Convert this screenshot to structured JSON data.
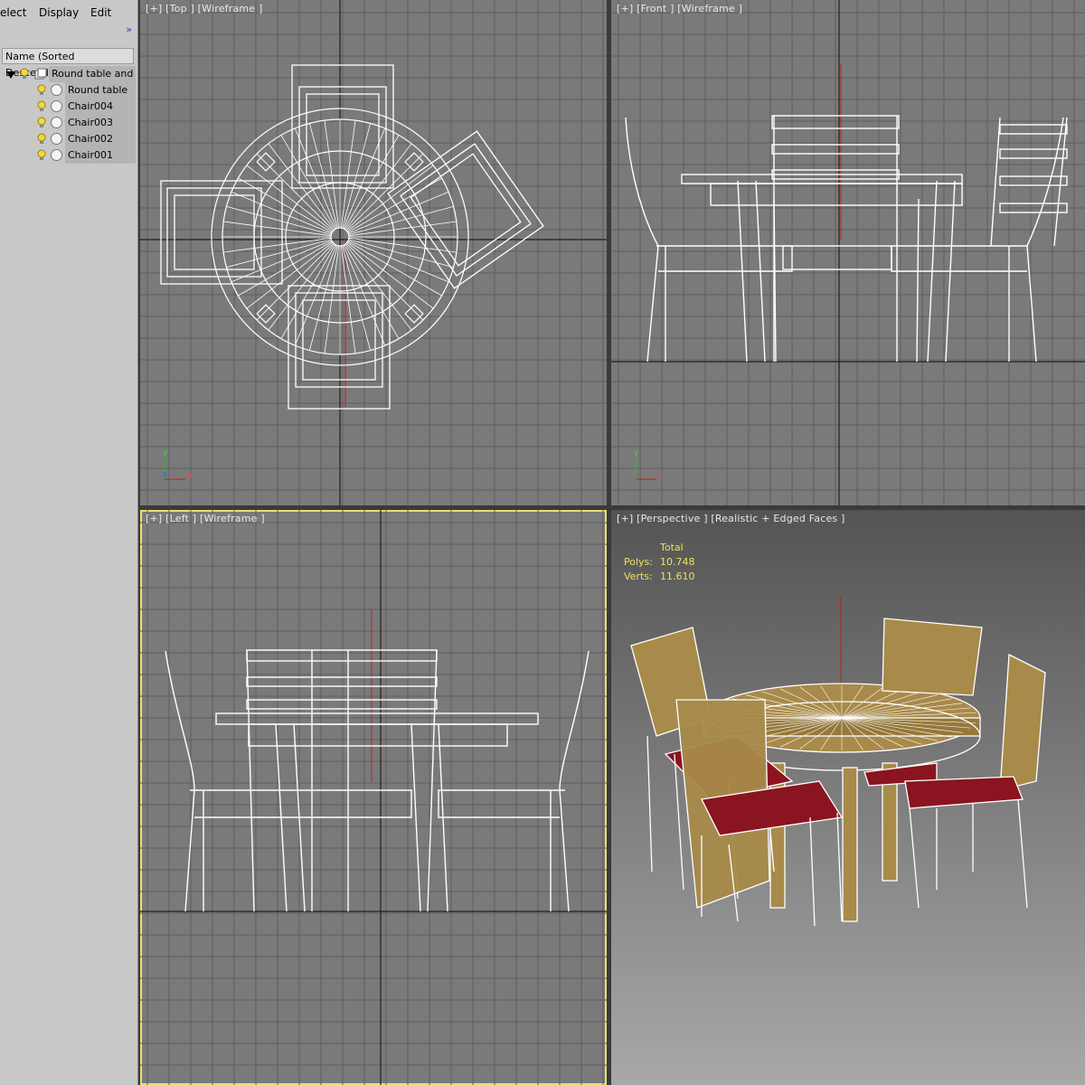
{
  "menubar": {
    "items": [
      "elect",
      "Display",
      "Edit"
    ],
    "expand_icon": "double-chevron-right-icon"
  },
  "scene_explorer": {
    "column_header": "Name (Sorted Descending)",
    "group": {
      "label": "Round table and ch",
      "icon": "group-icon"
    },
    "children": [
      {
        "label": "Round table"
      },
      {
        "label": "Chair004"
      },
      {
        "label": "Chair003"
      },
      {
        "label": "Chair002"
      },
      {
        "label": "Chair001"
      }
    ]
  },
  "viewports": {
    "top": {
      "label": "[+] [Top ] [Wireframe ]"
    },
    "front": {
      "label": "[+] [Front ] [Wireframe ]"
    },
    "left": {
      "label": "[+] [Left ] [Wireframe ]"
    },
    "perspective": {
      "label": "[+] [Perspective ] [Realistic + Edged Faces ]",
      "stats": {
        "total_label": "Total",
        "polys_label": "Polys:",
        "polys_value": "10.748",
        "verts_label": "Verts:",
        "verts_value": "11.610"
      }
    }
  },
  "axes": {
    "x": "x",
    "y": "y",
    "z": "z"
  },
  "colors": {
    "viewport_bg": "#7a7a7a",
    "grid": "#5e5e5e",
    "wire": "#ffffff",
    "active_outline": "#e8e070",
    "stats": "#f0e060",
    "wood": "#a88a4a",
    "seat": "#8a1420"
  }
}
